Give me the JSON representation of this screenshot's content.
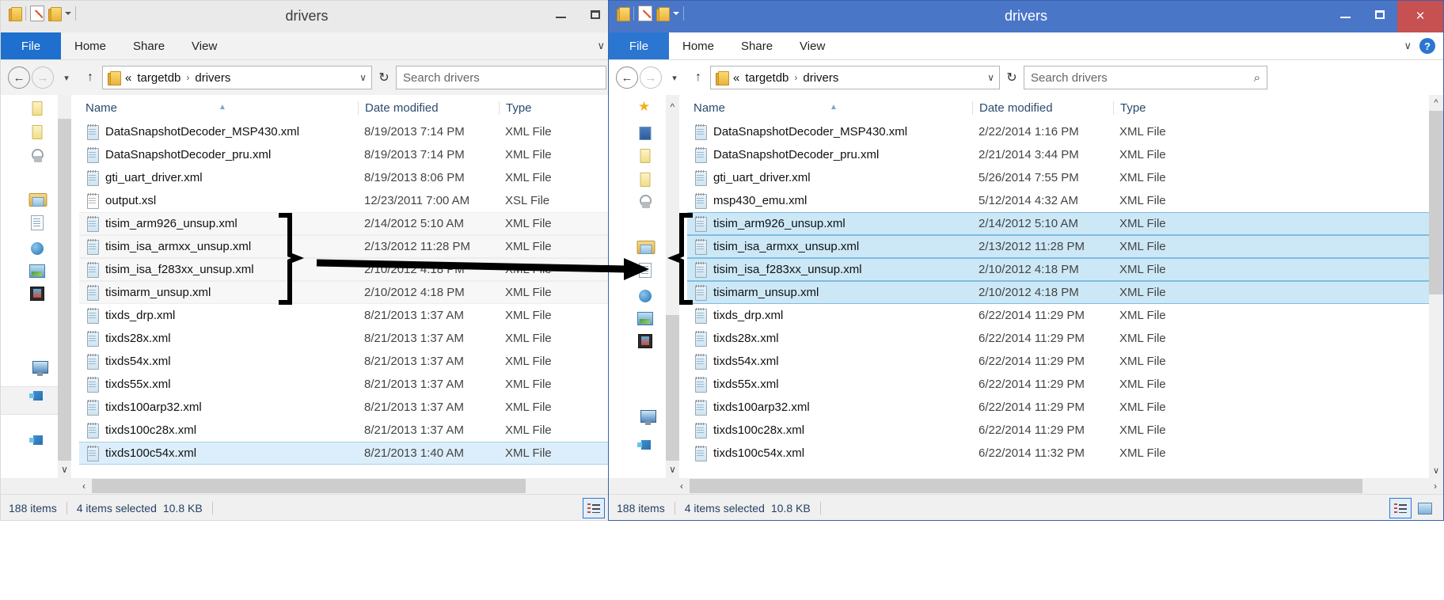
{
  "windows": [
    {
      "id": "left",
      "state": "inactive",
      "title": "drivers",
      "quick_access": [
        "folder-icon",
        "properties-icon",
        "new-folder-icon",
        "customize-caret-icon"
      ],
      "window_buttons": {
        "minimize": "–",
        "maximize": "☐",
        "close": ""
      },
      "ribbon": {
        "file_tab": "File",
        "tabs": [
          "Home",
          "Share",
          "View"
        ],
        "expand_caret": "∨"
      },
      "address": {
        "back": "←",
        "forward": "→",
        "recent_caret": "▾",
        "up": "↑",
        "crumb_prefix": "«",
        "crumbs": [
          "targetdb",
          "drivers"
        ],
        "crumb_sep": "›",
        "dropdown_caret": "∨",
        "refresh": "↻",
        "search_placeholder": "Search drivers",
        "search_icon": "⌕"
      },
      "columns": [
        "Name",
        "Date modified",
        "Type"
      ],
      "sort_column": "Name",
      "sort_direction": "ascending",
      "files": [
        {
          "name": "DataSnapshotDecoder_MSP430.xml",
          "date": "8/19/2013 7:14 PM",
          "type": "XML File",
          "icon": "xml-file-icon",
          "selected": false,
          "banded": false
        },
        {
          "name": "DataSnapshotDecoder_pru.xml",
          "date": "8/19/2013 7:14 PM",
          "type": "XML File",
          "icon": "xml-file-icon",
          "selected": false,
          "banded": false
        },
        {
          "name": "gti_uart_driver.xml",
          "date": "8/19/2013 8:06 PM",
          "type": "XML File",
          "icon": "xml-file-icon",
          "selected": false,
          "banded": false
        },
        {
          "name": "output.xsl",
          "date": "12/23/2011 7:00 AM",
          "type": "XSL File",
          "icon": "xsl-file-icon",
          "selected": false,
          "banded": false
        },
        {
          "name": "tisim_arm926_unsup.xml",
          "date": "2/14/2012 5:10 AM",
          "type": "XML File",
          "icon": "xml-file-icon",
          "selected": false,
          "banded": true
        },
        {
          "name": "tisim_isa_armxx_unsup.xml",
          "date": "2/13/2012 11:28 PM",
          "type": "XML File",
          "icon": "xml-file-icon",
          "selected": false,
          "banded": true
        },
        {
          "name": "tisim_isa_f283xx_unsup.xml",
          "date": "2/10/2012 4:18 PM",
          "type": "XML File",
          "icon": "xml-file-icon",
          "selected": false,
          "banded": true
        },
        {
          "name": "tisimarm_unsup.xml",
          "date": "2/10/2012 4:18 PM",
          "type": "XML File",
          "icon": "xml-file-icon",
          "selected": false,
          "banded": true
        },
        {
          "name": "tixds_drp.xml",
          "date": "8/21/2013 1:37 AM",
          "type": "XML File",
          "icon": "xml-file-icon",
          "selected": false,
          "banded": false
        },
        {
          "name": "tixds28x.xml",
          "date": "8/21/2013 1:37 AM",
          "type": "XML File",
          "icon": "xml-file-icon",
          "selected": false,
          "banded": false
        },
        {
          "name": "tixds54x.xml",
          "date": "8/21/2013 1:37 AM",
          "type": "XML File",
          "icon": "xml-file-icon",
          "selected": false,
          "banded": false
        },
        {
          "name": "tixds55x.xml",
          "date": "8/21/2013 1:37 AM",
          "type": "XML File",
          "icon": "xml-file-icon",
          "selected": false,
          "banded": false
        },
        {
          "name": "tixds100arp32.xml",
          "date": "8/21/2013 1:37 AM",
          "type": "XML File",
          "icon": "xml-file-icon",
          "selected": false,
          "banded": false
        },
        {
          "name": "tixds100c28x.xml",
          "date": "8/21/2013 1:37 AM",
          "type": "XML File",
          "icon": "xml-file-icon",
          "selected": false,
          "banded": false
        },
        {
          "name": "tixds100c54x.xml",
          "date": "8/21/2013 1:40 AM",
          "type": "XML File",
          "icon": "xml-file-icon",
          "selected": true,
          "banded": false
        }
      ],
      "status": {
        "item_count": "188 items",
        "selection": "4 items selected",
        "size": "10.8 KB"
      },
      "view_buttons": [
        "details-view-icon",
        "thumbnail-view-icon"
      ],
      "active_view": "details-view-icon"
    },
    {
      "id": "right",
      "state": "active",
      "title": "drivers",
      "quick_access": [
        "folder-icon",
        "properties-icon",
        "new-folder-icon",
        "customize-caret-icon"
      ],
      "window_buttons": {
        "minimize": "–",
        "maximize": "☐",
        "close": "×"
      },
      "ribbon": {
        "file_tab": "File",
        "tabs": [
          "Home",
          "Share",
          "View"
        ],
        "expand_caret": "∨",
        "help": "?"
      },
      "address": {
        "back": "←",
        "forward": "→",
        "recent_caret": "▾",
        "up": "↑",
        "crumb_prefix": "«",
        "crumbs": [
          "targetdb",
          "drivers"
        ],
        "crumb_sep": "›",
        "dropdown_caret": "∨",
        "refresh": "↻",
        "search_placeholder": "Search drivers",
        "search_icon": "⌕"
      },
      "columns": [
        "Name",
        "Date modified",
        "Type"
      ],
      "sort_column": "Name",
      "sort_direction": "ascending",
      "files": [
        {
          "name": "DataSnapshotDecoder_MSP430.xml",
          "date": "2/22/2014 1:16 PM",
          "type": "XML File",
          "icon": "xml-file-icon",
          "selected": false
        },
        {
          "name": "DataSnapshotDecoder_pru.xml",
          "date": "2/21/2014 3:44 PM",
          "type": "XML File",
          "icon": "xml-file-icon",
          "selected": false
        },
        {
          "name": "gti_uart_driver.xml",
          "date": "5/26/2014 7:55 PM",
          "type": "XML File",
          "icon": "xml-file-icon",
          "selected": false
        },
        {
          "name": "msp430_emu.xml",
          "date": "5/12/2014 4:32 AM",
          "type": "XML File",
          "icon": "xml-file-icon",
          "selected": false
        },
        {
          "name": "tisim_arm926_unsup.xml",
          "date": "2/14/2012 5:10 AM",
          "type": "XML File",
          "icon": "xml-file-icon",
          "selected": true
        },
        {
          "name": "tisim_isa_armxx_unsup.xml",
          "date": "2/13/2012 11:28 PM",
          "type": "XML File",
          "icon": "xml-file-icon",
          "selected": true
        },
        {
          "name": "tisim_isa_f283xx_unsup.xml",
          "date": "2/10/2012 4:18 PM",
          "type": "XML File",
          "icon": "xml-file-icon",
          "selected": true
        },
        {
          "name": "tisimarm_unsup.xml",
          "date": "2/10/2012 4:18 PM",
          "type": "XML File",
          "icon": "xml-file-icon",
          "selected": true
        },
        {
          "name": "tixds_drp.xml",
          "date": "6/22/2014 11:29 PM",
          "type": "XML File",
          "icon": "xml-file-icon",
          "selected": false
        },
        {
          "name": "tixds28x.xml",
          "date": "6/22/2014 11:29 PM",
          "type": "XML File",
          "icon": "xml-file-icon",
          "selected": false
        },
        {
          "name": "tixds54x.xml",
          "date": "6/22/2014 11:29 PM",
          "type": "XML File",
          "icon": "xml-file-icon",
          "selected": false
        },
        {
          "name": "tixds55x.xml",
          "date": "6/22/2014 11:29 PM",
          "type": "XML File",
          "icon": "xml-file-icon",
          "selected": false
        },
        {
          "name": "tixds100arp32.xml",
          "date": "6/22/2014 11:29 PM",
          "type": "XML File",
          "icon": "xml-file-icon",
          "selected": false
        },
        {
          "name": "tixds100c28x.xml",
          "date": "6/22/2014 11:29 PM",
          "type": "XML File",
          "icon": "xml-file-icon",
          "selected": false
        },
        {
          "name": "tixds100c54x.xml",
          "date": "6/22/2014 11:32 PM",
          "type": "XML File",
          "icon": "xml-file-icon",
          "selected": false
        }
      ],
      "status": {
        "item_count": "188 items",
        "selection": "4 items selected",
        "size": "10.8 KB"
      },
      "view_buttons": [
        "details-view-icon",
        "thumbnail-view-icon"
      ],
      "active_view": "details-view-icon"
    }
  ],
  "nav_pane_icons": [
    "favorites-star-icon",
    "desktop-icon",
    "downloads-folder-icon",
    "recent-folder-icon",
    "recent-places-icon",
    "libraries-icon",
    "documents-icon",
    "music-icon",
    "pictures-icon",
    "videos-icon",
    "homegroup-icon",
    "this-pc-icon",
    "network-icon"
  ],
  "annotation": {
    "type": "arrow-with-brackets",
    "color": "#000000",
    "description": "black arrow pointing from the four tisim files in the left window to the matching selected files in the right window"
  },
  "colors": {
    "active_title_bar": "#4a76c8",
    "inactive_title_bar": "#eaeaea",
    "close_button": "#c75050",
    "file_tab": "#2b76d0",
    "selection_blue": "#cce8f7",
    "selection_border": "#7fbde0",
    "status_text": "#243f63"
  }
}
